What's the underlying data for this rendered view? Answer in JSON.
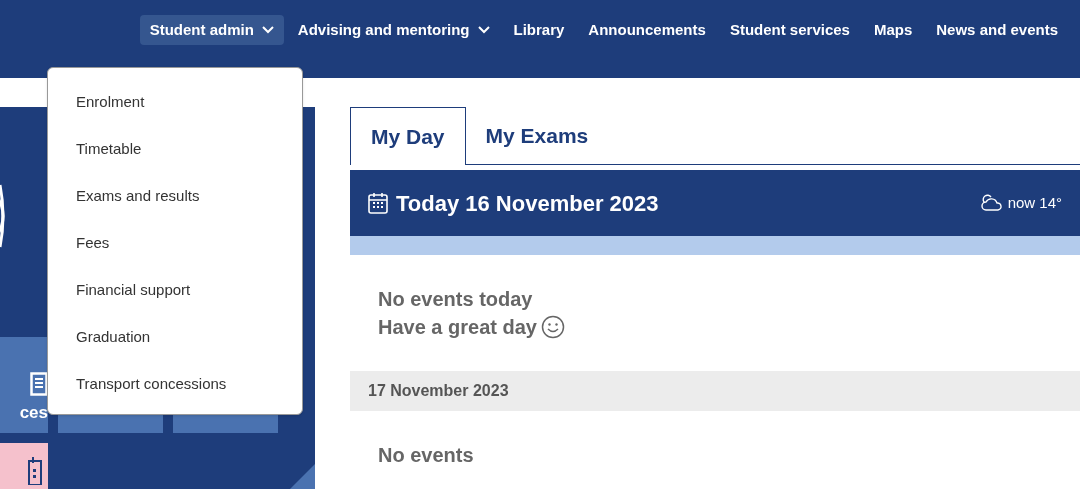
{
  "nav": [
    {
      "label": "Student admin",
      "dropdown": true,
      "selected": true
    },
    {
      "label": "Advising and mentoring",
      "dropdown": true,
      "selected": false
    },
    {
      "label": "Library",
      "dropdown": false,
      "selected": false
    },
    {
      "label": "Announcements",
      "dropdown": false,
      "selected": false
    },
    {
      "label": "Student services",
      "dropdown": false,
      "selected": false
    },
    {
      "label": "Maps",
      "dropdown": false,
      "selected": false
    },
    {
      "label": "News and events",
      "dropdown": false,
      "selected": false
    }
  ],
  "menu": {
    "expanded": true,
    "items": [
      "Enrolment",
      "Timetable",
      "Exams and results",
      "Fees",
      "Financial support",
      "Graduation",
      "Transport concessions"
    ]
  },
  "tiles": [
    {
      "label": "ces"
    }
  ],
  "tabs": [
    {
      "label": "My Day",
      "selected": true
    },
    {
      "label": "My Exams",
      "selected": false
    }
  ],
  "today": {
    "title": "Today 16 November 2023",
    "weather": "now 14°"
  },
  "days": [
    {
      "lines": [
        "No events today",
        "Have a great day"
      ],
      "smiley": true
    },
    {
      "heading": "17 November 2023",
      "lines": [
        "No events"
      ],
      "smiley": false
    }
  ]
}
